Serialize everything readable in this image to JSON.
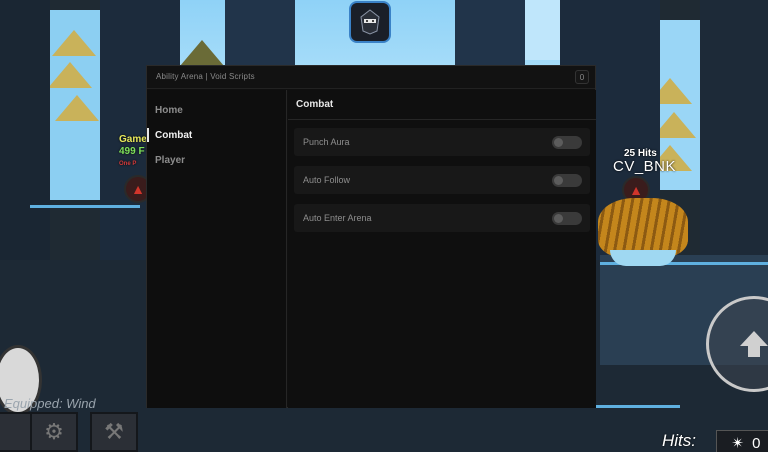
{
  "window": {
    "title": "Ability Arena | Void Scripts",
    "close_label": "0"
  },
  "sidebar": {
    "items": [
      {
        "label": "Home",
        "active": false
      },
      {
        "label": "Combat",
        "active": true
      },
      {
        "label": "Player",
        "active": false
      }
    ]
  },
  "combat": {
    "header": "Combat",
    "toggles": [
      {
        "label": "Punch Aura",
        "enabled": false
      },
      {
        "label": "Auto Follow",
        "enabled": false
      },
      {
        "label": "Auto Enter Arena",
        "enabled": false
      }
    ]
  },
  "game": {
    "left_player_name": "Gamer",
    "left_player_hp": "499 F",
    "left_player_sub": "One P",
    "right_player_hits": "25 Hits",
    "right_player_name": "CV_BNK",
    "equipped_label": "Equipped: Wind",
    "hits_label": "Hits:",
    "hits_value": "0"
  },
  "icons": {
    "logo": "ninja-icon",
    "emblem": "flame-emblem-icon",
    "hotbar": [
      "settings-gear-icon",
      "hammer-icon"
    ],
    "jump": "jump-arrow-icon"
  },
  "colors": {
    "window_bg": "#101010",
    "accent_logo_border": "#3a82c7",
    "toggle_off": "#3a3a3a"
  }
}
